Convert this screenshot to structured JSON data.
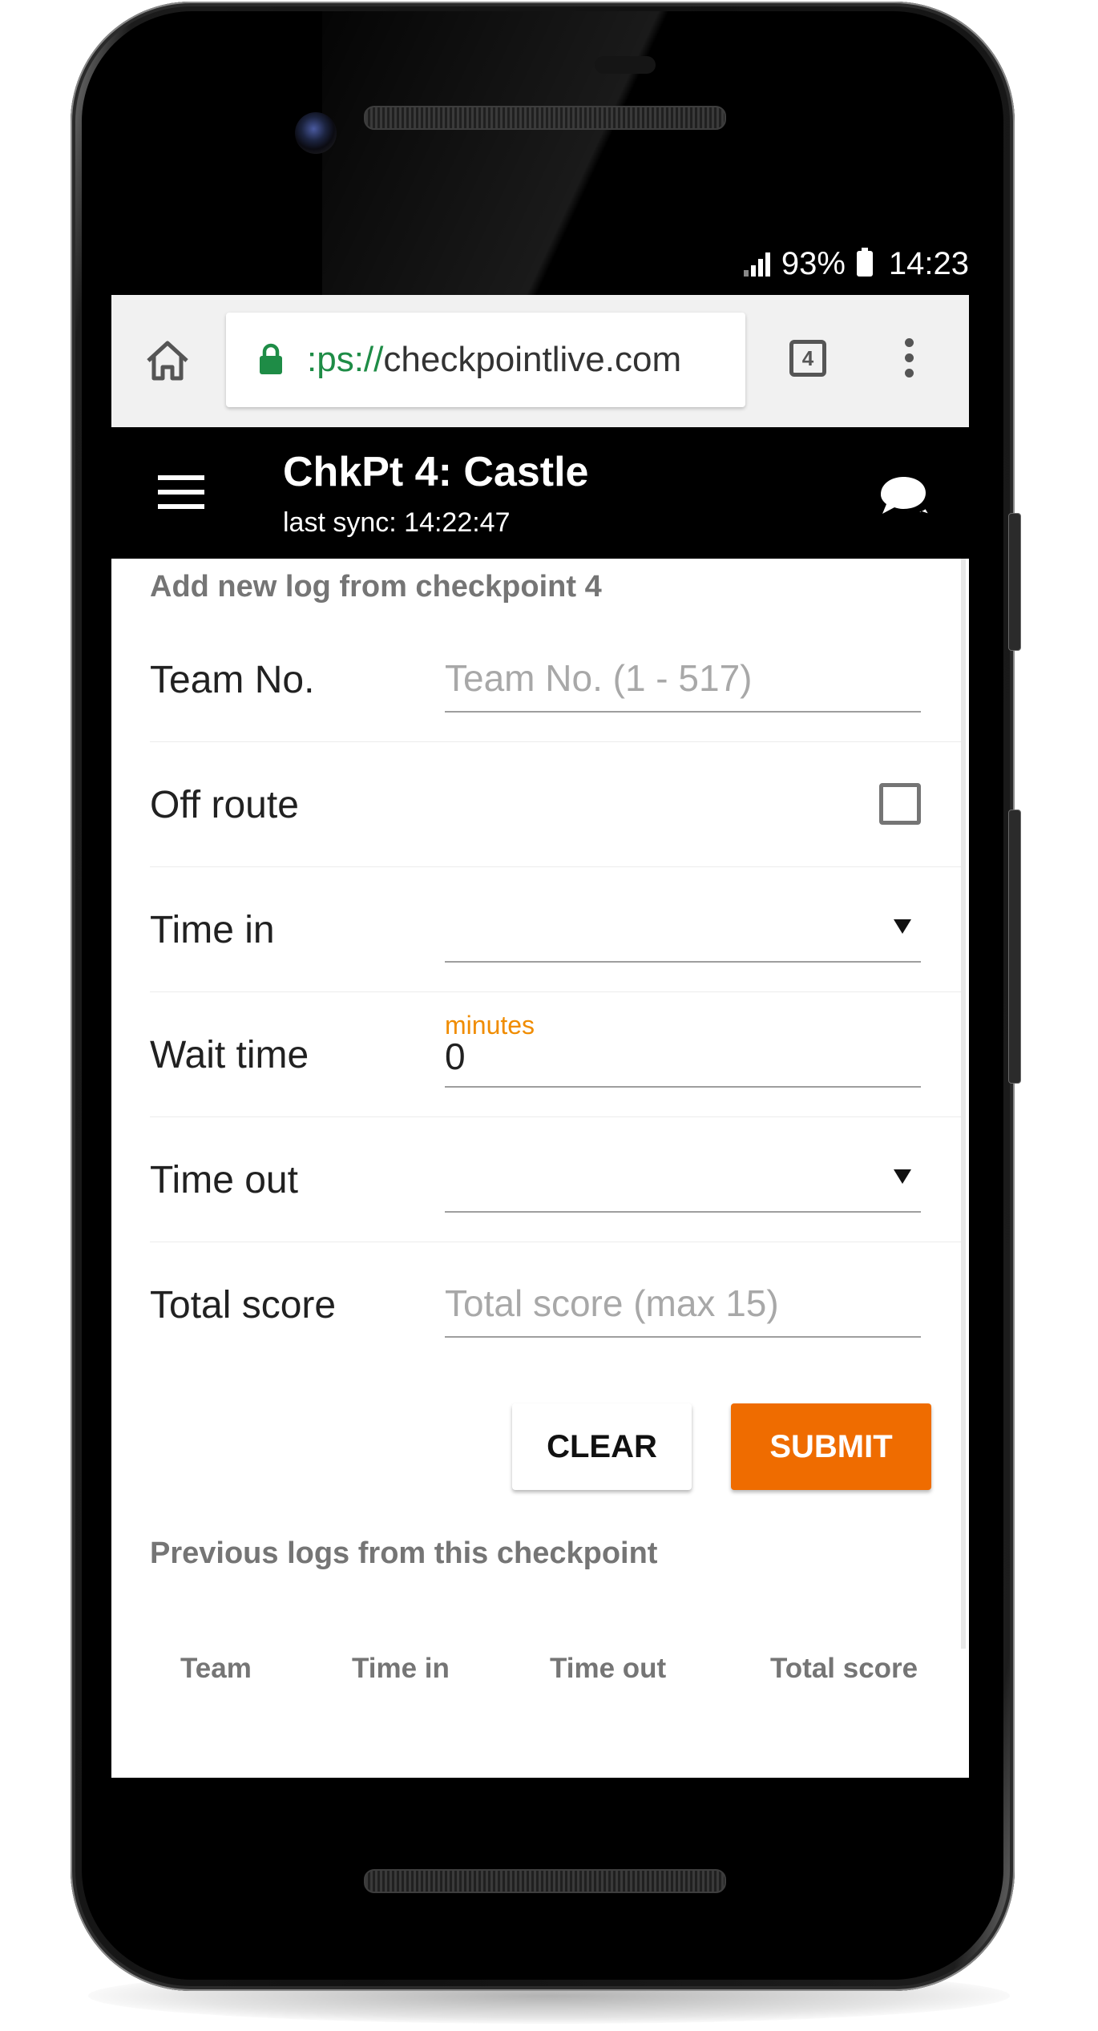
{
  "status_bar": {
    "battery": "93%",
    "time": "14:23"
  },
  "browser": {
    "url_scheme": ":ps://",
    "url_host": "checkpointlive.com",
    "tab_count": "4",
    "icons": [
      "home-icon",
      "lock-icon",
      "tabs-icon",
      "menu-dots-icon"
    ]
  },
  "app_bar": {
    "title": "ChkPt 4: Castle",
    "subtitle": "last sync: 14:22:47",
    "icons": [
      "hamburger-icon",
      "chat-icon"
    ]
  },
  "form": {
    "heading": "Add new log from checkpoint 4",
    "team_no": {
      "label": "Team No.",
      "placeholder": "Team No. (1 - 517)",
      "value": ""
    },
    "off_route": {
      "label": "Off route",
      "checked": false
    },
    "time_in": {
      "label": "Time in",
      "value": ""
    },
    "wait_time": {
      "label": "Wait time",
      "caption": "minutes",
      "value": "0"
    },
    "time_out": {
      "label": "Time out",
      "value": ""
    },
    "total_score": {
      "label": "Total score",
      "placeholder": "Total score (max 15)",
      "value": ""
    },
    "clear_label": "CLEAR",
    "submit_label": "SUBMIT"
  },
  "previous_logs": {
    "heading": "Previous logs from this checkpoint",
    "columns": [
      "Team",
      "Time in",
      "Time out",
      "Total score"
    ]
  },
  "colors": {
    "accent": "#ef6c00",
    "caption": "#f08c00",
    "url_scheme": "#1e8c46",
    "app_bar": "#000000"
  }
}
